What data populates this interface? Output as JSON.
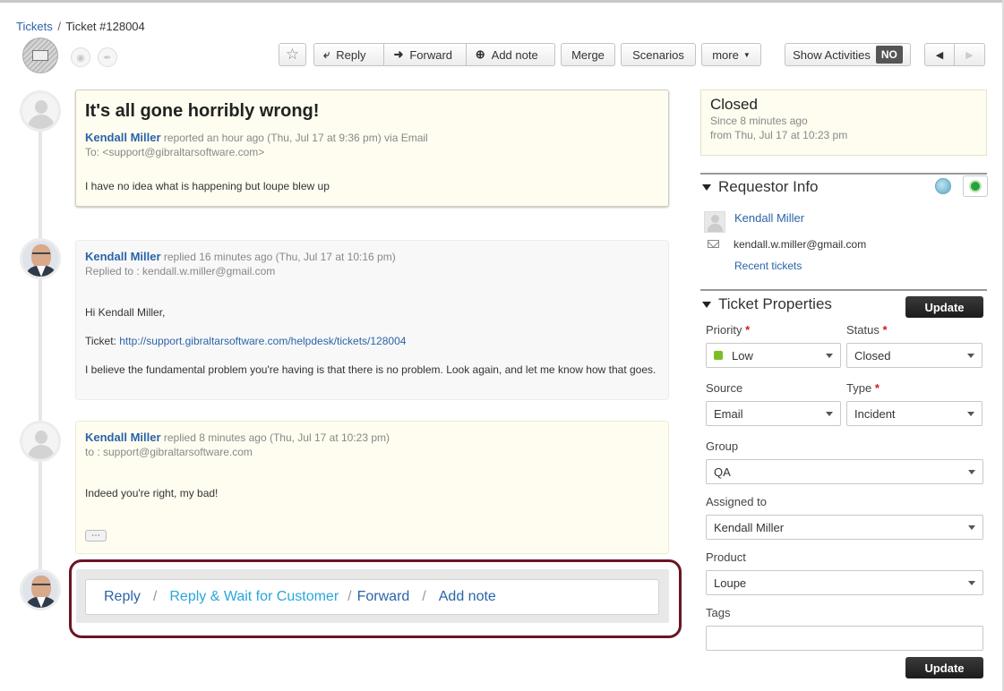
{
  "breadcrumb": {
    "tickets_link": "Tickets",
    "sep": "/",
    "current": "Ticket #128004"
  },
  "toolbar": {
    "star_icon": "star-icon",
    "reply": "Reply",
    "forward": "Forward",
    "add_note": "Add note",
    "merge": "Merge",
    "scenarios": "Scenarios",
    "more": "more",
    "show_activities": "Show Activities",
    "show_activities_state": "NO"
  },
  "conversation": [
    {
      "subject": "It's all gone horribly wrong!",
      "author": "Kendall Miller",
      "action": "reported an hour ago (Thu, Jul 17 at 9:36 pm) via Email",
      "to": "To: <support@gibraltarsoftware.com>",
      "body": "I have no idea what is happening but loupe blew up"
    },
    {
      "author": "Kendall Miller",
      "action": "replied 16 minutes ago (Thu, Jul 17 at 10:16 pm)",
      "to": "Replied to : kendall.w.miller@gmail.com",
      "greeting": "Hi Kendall Miller,",
      "ticket_label": "Ticket:",
      "ticket_url": "http://support.gibraltarsoftware.com/helpdesk/tickets/128004",
      "body": "I believe the fundamental problem you're having is that there is no problem.  Look again, and let me know how that goes."
    },
    {
      "author": "Kendall Miller",
      "action": "replied 8 minutes ago (Thu, Jul 17 at 10:23 pm)",
      "to": "to : support@gibraltarsoftware.com",
      "body": "Indeed you're right, my bad!",
      "more_label": "⋯"
    }
  ],
  "reply_bar": {
    "reply": "Reply",
    "reply_wait": "Reply & Wait for Customer",
    "forward": "Forward",
    "add_note": "Add note",
    "sep": "/"
  },
  "status": {
    "state": "Closed",
    "since": "Since 8 minutes ago",
    "from": "from Thu, Jul 17 at 10:23 pm"
  },
  "requestor": {
    "title": "Requestor Info",
    "name": "Kendall Miller",
    "email": "kendall.w.miller@gmail.com",
    "recent": "Recent tickets"
  },
  "properties": {
    "title": "Ticket Properties",
    "update": "Update",
    "priority_label": "Priority",
    "priority": "Low",
    "priority_color": "#7bbd29",
    "status_label": "Status",
    "status": "Closed",
    "source_label": "Source",
    "source": "Email",
    "type_label": "Type",
    "type": "Incident",
    "group_label": "Group",
    "group": "QA",
    "assigned_label": "Assigned to",
    "assigned": "Kendall Miller",
    "product_label": "Product",
    "product": "Loupe",
    "tags_label": "Tags",
    "tags": "",
    "required_mark": "*"
  },
  "colors": {
    "accent_link": "#2a64a8",
    "reply_wait": "#2aa7d8",
    "highlight_outline": "#6b1524"
  }
}
